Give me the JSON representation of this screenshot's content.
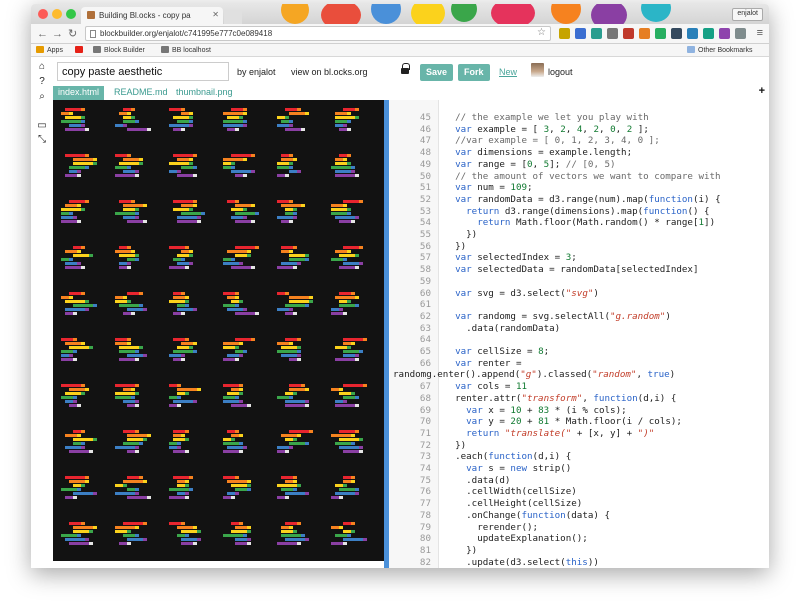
{
  "browser": {
    "tab_title": "Building Bl.ocks - copy pa",
    "url": "blockbuilder.org/enjalot/c741995e777c0e089418",
    "user_chip": "enjalot",
    "bookmarks": [
      "Apps",
      "Block Builder",
      "BB localhost"
    ],
    "other_bookmarks": "Other Bookmarks"
  },
  "app": {
    "title_value": "copy paste aesthetic",
    "by_label": "by enjalot",
    "view_label": "view on bl.ocks.org",
    "save_label": "Save",
    "fork_label": "Fork",
    "new_label": "New",
    "logout_label": "logout"
  },
  "file_tabs": [
    "index.html",
    "README.md",
    "thumbnail.png"
  ],
  "rail_icons": [
    "home-icon",
    "help-icon",
    "search-icon",
    "save-icon",
    "expand-icon"
  ],
  "code_lines": [
    {
      "n": "45",
      "html": "  <span class='com'>// the example we let you play with</span>"
    },
    {
      "n": "46",
      "html": "  <span class='kw'>var</span> example = [ <span class='num'>3</span>, <span class='num'>2</span>, <span class='num'>4</span>, <span class='num'>2</span>, <span class='num'>0</span>, <span class='num'>2</span> ];"
    },
    {
      "n": "47",
      "html": "  <span class='com'>//var example = [ 0, 1, 2, 3, 4, 0 ];</span>"
    },
    {
      "n": "48",
      "html": "  <span class='kw'>var</span> dimensions = example.length;"
    },
    {
      "n": "49",
      "html": "  <span class='kw'>var</span> range = [<span class='num'>0</span>, <span class='num'>5</span>]; <span class='com'>// [0, 5)</span>"
    },
    {
      "n": "50",
      "html": "  <span class='com'>// the amount of vectors we want to compare with</span>"
    },
    {
      "n": "51",
      "html": "  <span class='kw'>var</span> num = <span class='num'>109</span>;"
    },
    {
      "n": "52",
      "html": "  <span class='kw'>var</span> randomData = d3.range(num).map(<span class='kw'>function</span>(i) {"
    },
    {
      "n": "53",
      "html": "    <span class='kw'>return</span> d3.range(dimensions).map(<span class='kw'>function</span>() {"
    },
    {
      "n": "54",
      "html": "      <span class='kw'>return</span> Math.floor(Math.random() * range[<span class='num'>1</span>])"
    },
    {
      "n": "55",
      "html": "    })"
    },
    {
      "n": "56",
      "html": "  })"
    },
    {
      "n": "57",
      "html": "  <span class='kw'>var</span> selectedIndex = <span class='num'>3</span>;"
    },
    {
      "n": "58",
      "html": "  <span class='kw'>var</span> selectedData = randomData[selectedIndex]"
    },
    {
      "n": "59",
      "html": ""
    },
    {
      "n": "60",
      "html": "  <span class='kw'>var</span> svg = d3.select(<span class='str'>\"svg\"</span>)"
    },
    {
      "n": "61",
      "html": ""
    },
    {
      "n": "62",
      "html": "  <span class='kw'>var</span> randomg = svg.selectAll(<span class='str'>\"g.random\"</span>)"
    },
    {
      "n": "63",
      "html": "    .data(randomData)"
    },
    {
      "n": "64",
      "html": ""
    },
    {
      "n": "65",
      "html": "  <span class='kw'>var</span> cellSize = <span class='num'>8</span>;"
    },
    {
      "n": "66",
      "html": "  <span class='kw'>var</span> renter ="
    },
    {
      "n": "",
      "html": "randomg.enter().append(<span class='str'>\"g\"</span>).classed(<span class='str'>\"random\"</span>, <span class='kw'>true</span>)"
    },
    {
      "n": "67",
      "html": "  <span class='kw'>var</span> cols = <span class='num'>11</span>"
    },
    {
      "n": "68",
      "html": "  renter.attr(<span class='str'>\"transform\"</span>, <span class='kw'>function</span>(d,i) {"
    },
    {
      "n": "69",
      "html": "    <span class='kw'>var</span> x = <span class='num'>10</span> + <span class='num'>83</span> * (i % cols);"
    },
    {
      "n": "70",
      "html": "    <span class='kw'>var</span> y = <span class='num'>20</span> + <span class='num'>81</span> * Math.floor(i / cols);"
    },
    {
      "n": "71",
      "html": "    <span class='kw'>return</span> <span class='str'>\"translate(\"</span> + [x, y] + <span class='str'>\")\"</span>"
    },
    {
      "n": "72",
      "html": "  })"
    },
    {
      "n": "73",
      "html": "  .each(<span class='kw'>function</span>(d,i) {"
    },
    {
      "n": "74",
      "html": "    <span class='kw'>var</span> s = <span class='kw'>new</span> strip()"
    },
    {
      "n": "75",
      "html": "    .data(d)"
    },
    {
      "n": "76",
      "html": "    .cellWidth(cellSize)"
    },
    {
      "n": "77",
      "html": "    .cellHeight(cellSize)"
    },
    {
      "n": "78",
      "html": "    .onChange(<span class='kw'>function</span>(data) {"
    },
    {
      "n": "79",
      "html": "      rerender();"
    },
    {
      "n": "80",
      "html": "      updateExplanation();"
    },
    {
      "n": "81",
      "html": "    })"
    },
    {
      "n": "82",
      "html": "    .update(d3.select(<span class='kw'>this</span>))"
    }
  ],
  "colors": {
    "accent": "#68b5a9",
    "divider": "#4a90d9",
    "canvas_bg": "#121212",
    "strip_palette": [
      "#e8252f",
      "#f6821f",
      "#fbd21c",
      "#3aa64a",
      "#3c7fc4",
      "#8a3fa3",
      "#e5e5e5"
    ]
  }
}
